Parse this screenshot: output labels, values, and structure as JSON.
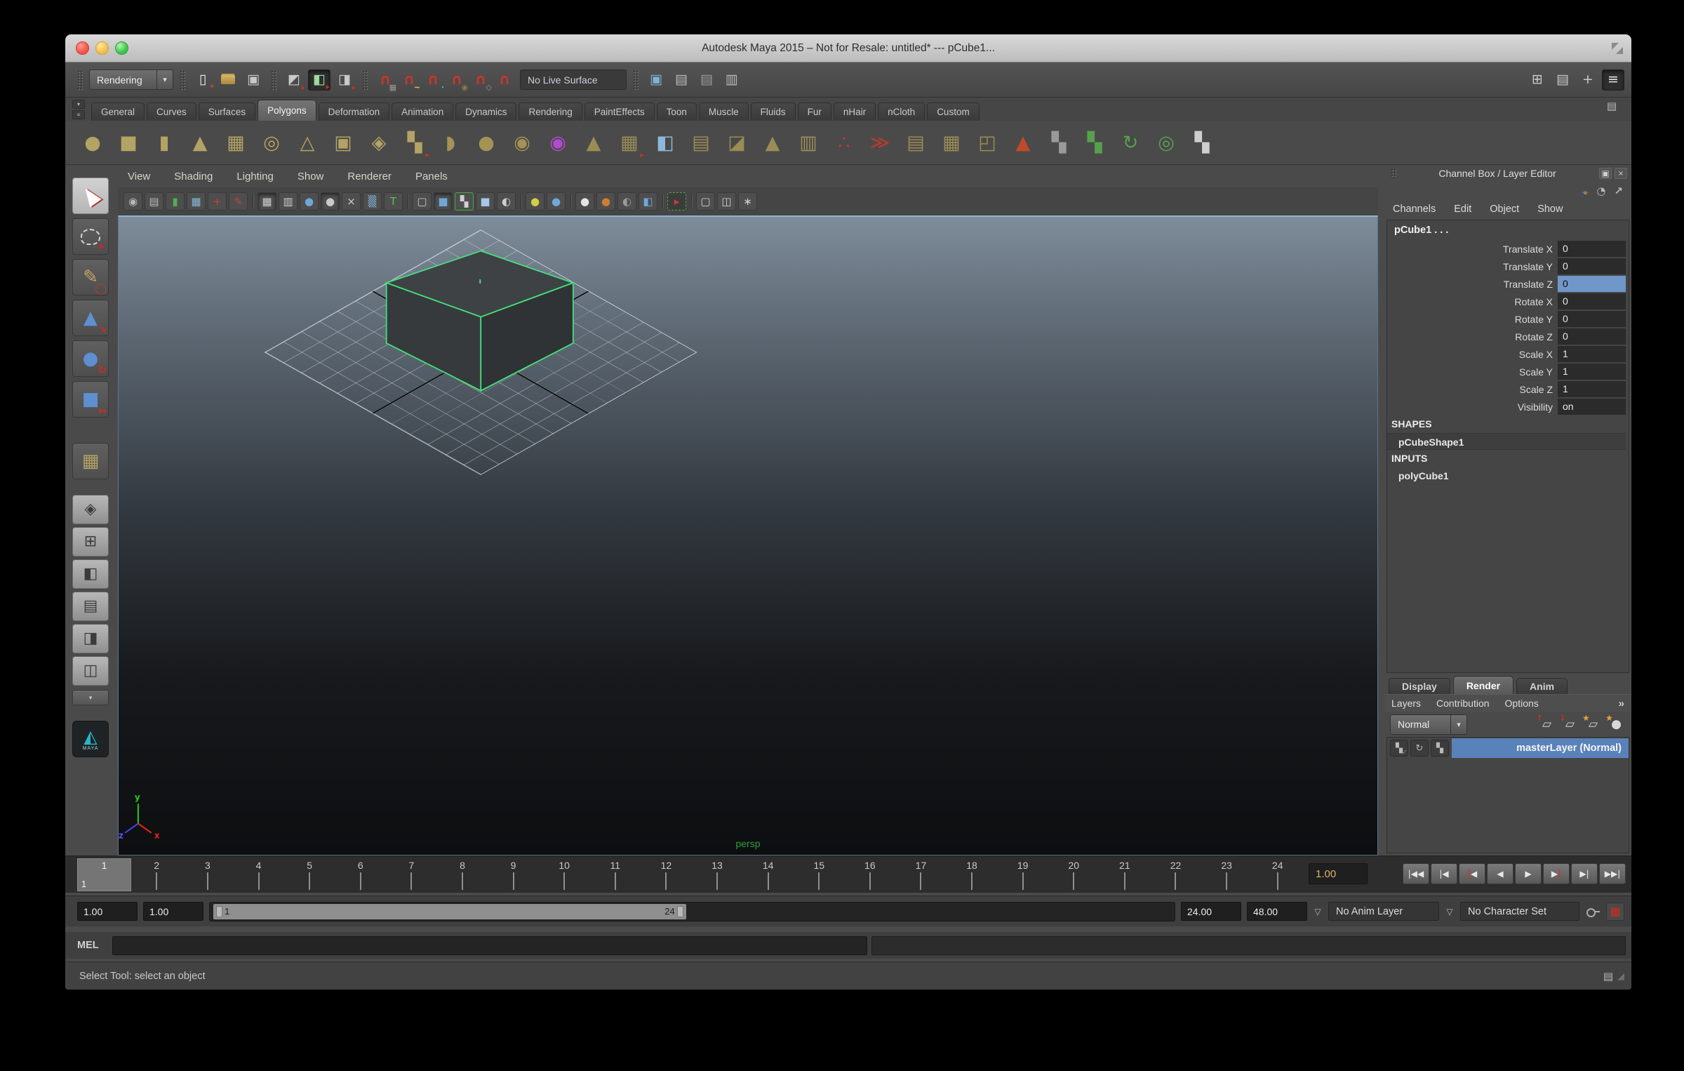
{
  "window": {
    "title": "Autodesk Maya 2015 – Not for Resale: untitled*   ---   pCube1...",
    "traffic_lights": [
      "close",
      "minimize",
      "zoom"
    ]
  },
  "colors": {
    "selection_blue": "#5a82ba",
    "cell_highlight": "#7097c9",
    "wireframe_green": "#44df7c",
    "viewport_top": "#7e8c9a",
    "viewport_bottom": "#0d0e10",
    "shelf_gold": "#b3a364"
  },
  "status_line": {
    "menu_set": "Rendering",
    "menu_set_arrow": "▾",
    "live_surface": "No Live Surface",
    "file_icons": [
      {
        "n": "new-scene-icon",
        "g": "▯",
        "gc": "#ececec",
        "a": "*",
        "ac": "#cc4437"
      },
      {
        "n": "open-scene-icon",
        "cls": "fold"
      },
      {
        "n": "save-scene-icon",
        "g": "▣",
        "gc": "#c8c8c8"
      }
    ],
    "selection_icons": [
      {
        "n": "select-hierarchy-icon",
        "g": "◩",
        "gc": "#c9c9c9",
        "a": "▸",
        "ac": "#cc2a20"
      },
      {
        "n": "select-object-icon",
        "g": "◧",
        "gc": "#9fd89f",
        "a": "▸",
        "ac": "#cc2a20",
        "cls": "pressed"
      },
      {
        "n": "select-component-icon",
        "g": "◨",
        "gc": "#c9c9c9",
        "a": "▸",
        "ac": "#cc2a20"
      }
    ],
    "snap_icons": [
      {
        "n": "snap-to-grid-icon",
        "g": "∩",
        "gc": "#c0392b",
        "a": "▦",
        "ac": "#9a9a9a"
      },
      {
        "n": "snap-to-curve-icon",
        "g": "∩",
        "gc": "#c0392b",
        "a": "~",
        "ac": "#e8d44a"
      },
      {
        "n": "snap-to-point-icon",
        "g": "∩",
        "gc": "#c0392b",
        "a": "∙",
        "ac": "#6fa8d8"
      },
      {
        "n": "snap-to-projected-center-icon",
        "g": "∩",
        "gc": "#c0392b",
        "a": "◉",
        "ac": "#8a7d42"
      },
      {
        "n": "snap-to-view-plane-icon",
        "g": "∩",
        "gc": "#c0392b",
        "a": "◇",
        "ac": "#9a9a9a"
      },
      {
        "n": "make-live-icon",
        "g": "∩",
        "gc": "#c0392b"
      }
    ],
    "render_icons": [
      {
        "n": "render-view-icon",
        "g": "▣",
        "gc": "#7fb3d6"
      },
      {
        "n": "render-current-frame-icon",
        "g": "▤",
        "gc": "#b9b9b9"
      },
      {
        "n": "ipr-render-icon",
        "g": "▤",
        "gc": "#9a9a9a"
      },
      {
        "n": "render-settings-icon",
        "g": "▥",
        "gc": "#b9b9b9"
      }
    ],
    "sidebar_icons": [
      {
        "n": "modeling-toolkit-toggle-icon",
        "g": "⊞",
        "gc": "#c9c9c9"
      },
      {
        "n": "attribute-editor-toggle-icon",
        "g": "▤",
        "gc": "#c9c9c9"
      },
      {
        "n": "tool-settings-toggle-icon",
        "g": "+",
        "gc": "#c9c9c9"
      },
      {
        "n": "channel-box-toggle-icon",
        "g": "≡",
        "gc": "#e2e2e2",
        "cls": "pressed"
      }
    ]
  },
  "shelf": {
    "left_buttons": [
      {
        "n": "shelf-tab-toggle-icon",
        "g": "▾"
      },
      {
        "n": "shelf-menu-icon",
        "g": "≡"
      }
    ],
    "editor_icon": {
      "g": "▤"
    },
    "tabs": [
      {
        "label": "General"
      },
      {
        "label": "Curves"
      },
      {
        "label": "Surfaces"
      },
      {
        "label": "Polygons",
        "cls": "active"
      },
      {
        "label": "Deformation"
      },
      {
        "label": "Animation"
      },
      {
        "label": "Dynamics"
      },
      {
        "label": "Rendering"
      },
      {
        "label": "PaintEffects"
      },
      {
        "label": "Toon"
      },
      {
        "label": "Muscle"
      },
      {
        "label": "Fluids"
      },
      {
        "label": "Fur"
      },
      {
        "label": "nHair"
      },
      {
        "label": "nCloth"
      },
      {
        "label": "Custom"
      }
    ],
    "icons": [
      {
        "n": "poly-sphere-icon",
        "g": "●",
        "gc": "#b3a364"
      },
      {
        "n": "poly-cube-icon",
        "g": "■",
        "gc": "#b3a364"
      },
      {
        "n": "poly-cylinder-icon",
        "g": "▮",
        "gc": "#b3a364"
      },
      {
        "n": "poly-cone-icon",
        "g": "▲",
        "gc": "#b3a364"
      },
      {
        "n": "poly-plane-icon",
        "g": "▦",
        "gc": "#b3a364"
      },
      {
        "n": "poly-torus-icon",
        "g": "◎",
        "gc": "#b3a364"
      },
      {
        "n": "poly-pyramid-icon",
        "g": "△",
        "gc": "#b3a364"
      },
      {
        "n": "poly-pipe-icon",
        "g": "▣",
        "gc": "#b3a364"
      },
      {
        "n": "poly-platonic-icon",
        "g": "◈",
        "gc": "#b3a364"
      },
      {
        "n": "combine-icon",
        "g": "▚",
        "gc": "#b3a364",
        "a": "▸",
        "ac": "#c0392b"
      },
      {
        "n": "separate-icon",
        "g": "◗",
        "gc": "#a39455"
      },
      {
        "n": "smooth-icon",
        "g": "●",
        "gc": "#a39455"
      },
      {
        "n": "subdiv-proxy-icon",
        "g": "◉",
        "gc": "#a39455"
      },
      {
        "n": "interactive-split-icon",
        "g": "◉",
        "gc": "#b04ad0"
      },
      {
        "n": "triangulate-icon",
        "g": "▲",
        "gc": "#9b8c55"
      },
      {
        "n": "quadrangulate-icon",
        "g": "▦",
        "gc": "#9b8c55",
        "a": "▸",
        "ac": "#c0392b"
      },
      {
        "n": "append-polygon-icon",
        "g": "◧",
        "gc": "#8fb7d9"
      },
      {
        "n": "insert-edge-loop-icon",
        "g": "▤",
        "gc": "#9b8c55"
      },
      {
        "n": "offset-edge-loop-icon",
        "g": "◪",
        "gc": "#9b8c55"
      },
      {
        "n": "extrude-icon",
        "g": "▲",
        "gc": "#9b8c55"
      },
      {
        "n": "bridge-icon",
        "g": "▥",
        "gc": "#9b8c55"
      },
      {
        "n": "poke-icon",
        "g": "∴",
        "gc": "#c0392b"
      },
      {
        "n": "wedge-icon",
        "g": "≫",
        "gc": "#c0392b"
      },
      {
        "n": "duplicate-face-icon",
        "g": "▤",
        "gc": "#9b8c55"
      },
      {
        "n": "bevel-icon",
        "g": "▦",
        "gc": "#9b8c55"
      },
      {
        "n": "crease-icon",
        "g": "◰",
        "gc": "#9b8c55"
      },
      {
        "n": "sculpt-icon",
        "g": "▲",
        "gc": "#c04a28"
      },
      {
        "n": "uv-checker-icon",
        "g": "▚",
        "gc": "#9a9a9a"
      },
      {
        "n": "uv-snapshot-icon",
        "g": "▚",
        "gc": "#57a14e"
      },
      {
        "n": "normals-icon",
        "g": "↻",
        "gc": "#57a14e"
      },
      {
        "n": "map-uv-border-icon",
        "g": "◎",
        "gc": "#57a14e"
      },
      {
        "n": "checker-cube-icon",
        "g": "▚",
        "gc": "#cfcfcf"
      }
    ]
  },
  "toolbox": {
    "tools": [
      {
        "n": "select-tool",
        "cls": "active",
        "shape": "cursor"
      },
      {
        "n": "lasso-select-tool",
        "shape": "lasso"
      },
      {
        "n": "paint-select-tool",
        "g": "✎",
        "gc": "#c8a36a",
        "a": "◯",
        "ac": "#c0392b"
      },
      {
        "n": "move-tool",
        "g": "▲",
        "gc": "#5f8fd0",
        "a": "↘",
        "ac": "#cc2a20"
      },
      {
        "n": "rotate-tool",
        "g": "●",
        "gc": "#5f8fd0",
        "a": "↻",
        "ac": "#cc2a20"
      },
      {
        "n": "scale-tool",
        "g": "■",
        "gc": "#5f8fd0",
        "a": "↔",
        "ac": "#cc2a20"
      }
    ],
    "last_tool": {
      "n": "last-tool-poly-cube",
      "g": "▦",
      "gc": "#b3a364"
    },
    "layouts": [
      {
        "n": "layout-single-pane",
        "g": "◈"
      },
      {
        "n": "layout-four-pane",
        "g": "⊞"
      },
      {
        "n": "layout-persp-outliner",
        "g": "◧"
      },
      {
        "n": "layout-persp-graph",
        "g": "▤"
      },
      {
        "n": "layout-hypershade",
        "g": "◨"
      },
      {
        "n": "layout-persp-uv",
        "g": "◫"
      }
    ],
    "layout_dropdown_arrow": "▾",
    "logo_text": "MAYA",
    "logo_glyph": "◭"
  },
  "viewport": {
    "menus": [
      "View",
      "Shading",
      "Lighting",
      "Show",
      "Renderer",
      "Panels"
    ],
    "icons": [
      {
        "n": "select-camera-icon",
        "g": "◉",
        "gc": "#b8b8b8"
      },
      {
        "n": "camera-attributes-icon",
        "g": "▤",
        "gc": "#b8b8b8"
      },
      {
        "n": "bookmark-icon",
        "g": "▮",
        "gc": "#4fae54"
      },
      {
        "n": "image-plane-icon",
        "g": "▦",
        "gc": "#86b7d8"
      },
      {
        "n": "pan-zoom-icon",
        "g": "+",
        "gc": "#c24338"
      },
      {
        "n": "grease-pencil-icon",
        "g": "✎",
        "gc": "#c24338"
      },
      {
        "n": "separator",
        "cls": "vsep"
      },
      {
        "n": "grid-toggle-icon",
        "g": "▦",
        "gc": "#cfcfcf",
        "cls": "pressed"
      },
      {
        "n": "film-gate-icon",
        "g": "▥",
        "gc": "#cfcfcf"
      },
      {
        "n": "shaded-display-icon",
        "g": "●",
        "gc": "#6fa8d8"
      },
      {
        "n": "default-material-icon",
        "g": "●",
        "gc": "#c9c9c9",
        "cls": "pressed"
      },
      {
        "n": "wireframe-on-shaded-icon",
        "g": "×",
        "gc": "#cfcfcf"
      },
      {
        "n": "textured-icon",
        "g": "▒",
        "gc": "#7fb3d6"
      },
      {
        "n": "annotation-icon",
        "g": "T",
        "gc": "#57c05a"
      },
      {
        "n": "separator",
        "cls": "vsep"
      },
      {
        "n": "wireframe-cube-icon",
        "g": "▢",
        "gc": "#c9c9c9"
      },
      {
        "n": "smooth-shade-icon",
        "g": "■",
        "gc": "#6fa8d8",
        "cls": "pressed"
      },
      {
        "n": "use-all-lights-icon",
        "g": "▚",
        "gc": "#cfcfcf",
        "cls": "frame"
      },
      {
        "n": "textured-cube-icon",
        "g": "■",
        "gc": "#a5c9e8"
      },
      {
        "n": "material-ball-icon",
        "g": "◐",
        "gc": "#d0d0d0"
      },
      {
        "n": "separator",
        "cls": "vsep"
      },
      {
        "n": "default-lighting-icon",
        "g": "●",
        "gc": "#d4cf3e"
      },
      {
        "n": "scene-lighting-icon",
        "g": "●",
        "gc": "#6fa8d8"
      },
      {
        "n": "separator",
        "cls": "vsep"
      },
      {
        "n": "shadows-icon",
        "g": "●",
        "gc": "#e6e6e6"
      },
      {
        "n": "ambient-occlusion-icon",
        "g": "●",
        "gc": "#cd7d33"
      },
      {
        "n": "motion-blur-icon",
        "g": "◐",
        "gc": "#9a9a9a"
      },
      {
        "n": "multisample-icon",
        "g": "◧",
        "gc": "#6fa8d8"
      },
      {
        "n": "separator",
        "cls": "vsep"
      },
      {
        "n": "isolate-select-icon",
        "g": "▸",
        "gc": "#c24338",
        "cls": "dashed"
      },
      {
        "n": "separator",
        "cls": "vsep"
      },
      {
        "n": "xray-icon",
        "g": "▢",
        "gc": "#cfcfcf"
      },
      {
        "n": "xray-active-icon",
        "g": "◫",
        "gc": "#cfcfcf"
      },
      {
        "n": "joint-xray-icon",
        "g": "∗",
        "gc": "#cfcfcf"
      }
    ],
    "camera_label": "persp",
    "axis": {
      "x": "x",
      "y": "y",
      "z": "z"
    }
  },
  "channel_box": {
    "title": "Channel Box / Layer Editor",
    "float_button": "▣",
    "close_button": "×",
    "tool_icons": [
      "axis-manipulator-icon",
      "speed-dial-icon",
      "pick-arrow-icon"
    ],
    "dial_glyph": "◔",
    "arrow_glyph": "↗",
    "menus": [
      "Channels",
      "Edit",
      "Object",
      "Show"
    ],
    "object_name": "pCube1 . . .",
    "attributes": [
      {
        "label": "Translate X",
        "value": "0"
      },
      {
        "label": "Translate Y",
        "value": "0"
      },
      {
        "label": "Translate Z",
        "value": "0",
        "sel": "sel"
      },
      {
        "label": "Rotate X",
        "value": "0"
      },
      {
        "label": "Rotate Y",
        "value": "0"
      },
      {
        "label": "Rotate Z",
        "value": "0"
      },
      {
        "label": "Scale X",
        "value": "1"
      },
      {
        "label": "Scale Y",
        "value": "1"
      },
      {
        "label": "Scale Z",
        "value": "1"
      },
      {
        "label": "Visibility",
        "value": "on"
      }
    ],
    "shapes_header": "SHAPES",
    "shape_name": "pCubeShape1",
    "inputs_header": "INPUTS",
    "input_name": "polyCube1"
  },
  "layer_editor": {
    "tabs": [
      {
        "label": "Display"
      },
      {
        "label": "Render",
        "cls": "active"
      },
      {
        "label": "Anim"
      }
    ],
    "menus": [
      "Layers",
      "Contribution",
      "Options"
    ],
    "overflow": "»",
    "blend_mode": "Normal",
    "blend_arrow": "▾",
    "layer_icons": [
      {
        "n": "move-layer-up-icon",
        "g": "▱",
        "a": "↑",
        "ac": "#c03328"
      },
      {
        "n": "move-layer-down-icon",
        "g": "▱",
        "a": "↓",
        "ac": "#c03328"
      },
      {
        "n": "new-empty-layer-icon",
        "g": "▱",
        "a": "★",
        "ac": "#e8a33a"
      },
      {
        "n": "new-layer-with-selected-icon",
        "g": "●",
        "a": "★",
        "ac": "#e8a33a"
      }
    ],
    "layer_toggles": [
      {
        "n": "layer-renderable-toggle",
        "g": "▚",
        "a": "✓",
        "ac": "#3fae44"
      },
      {
        "n": "layer-refresh-toggle",
        "g": "↻"
      },
      {
        "n": "layer-overrides-toggle",
        "g": "▚"
      }
    ],
    "layers": [
      {
        "name": "masterLayer (Normal)"
      }
    ]
  },
  "timeline": {
    "current": "1",
    "current_sub": "1",
    "rest": [
      "2",
      "3",
      "4",
      "5",
      "6",
      "7",
      "8",
      "9",
      "10",
      "11",
      "12",
      "13",
      "14",
      "15",
      "16",
      "17",
      "18",
      "19",
      "20",
      "21",
      "22",
      "23",
      "24"
    ]
  },
  "playback": {
    "current_time": "1.00",
    "transport": [
      {
        "n": "go-to-start-button",
        "g": "|◀◀"
      },
      {
        "n": "step-back-frame-button",
        "g": "|◀"
      },
      {
        "n": "step-back-key-button",
        "pre": "|",
        "g": "◀"
      },
      {
        "n": "play-backwards-button",
        "g": "◀"
      },
      {
        "n": "play-forwards-button",
        "g": "▶"
      },
      {
        "n": "step-forward-key-button",
        "g": "▶",
        "post": "|"
      },
      {
        "n": "step-forward-frame-button",
        "g": "▶|"
      },
      {
        "n": "go-to-end-button",
        "g": "▶▶|"
      }
    ]
  },
  "range_slider": {
    "animation_start": "1.00",
    "playback_start": "1.00",
    "range_start": "1",
    "range_end": "24",
    "playback_end": "24.00",
    "animation_end": "48.00",
    "anim_layer": "No Anim Layer",
    "character_set": "No Character Set",
    "dropdown_glyph": "▽",
    "autokey_glyph": "▦"
  },
  "command_line": {
    "label": "MEL"
  },
  "help_line": {
    "text": "Select Tool: select an object",
    "icon_glyph": "▤",
    "corner_glyph": "◢"
  }
}
